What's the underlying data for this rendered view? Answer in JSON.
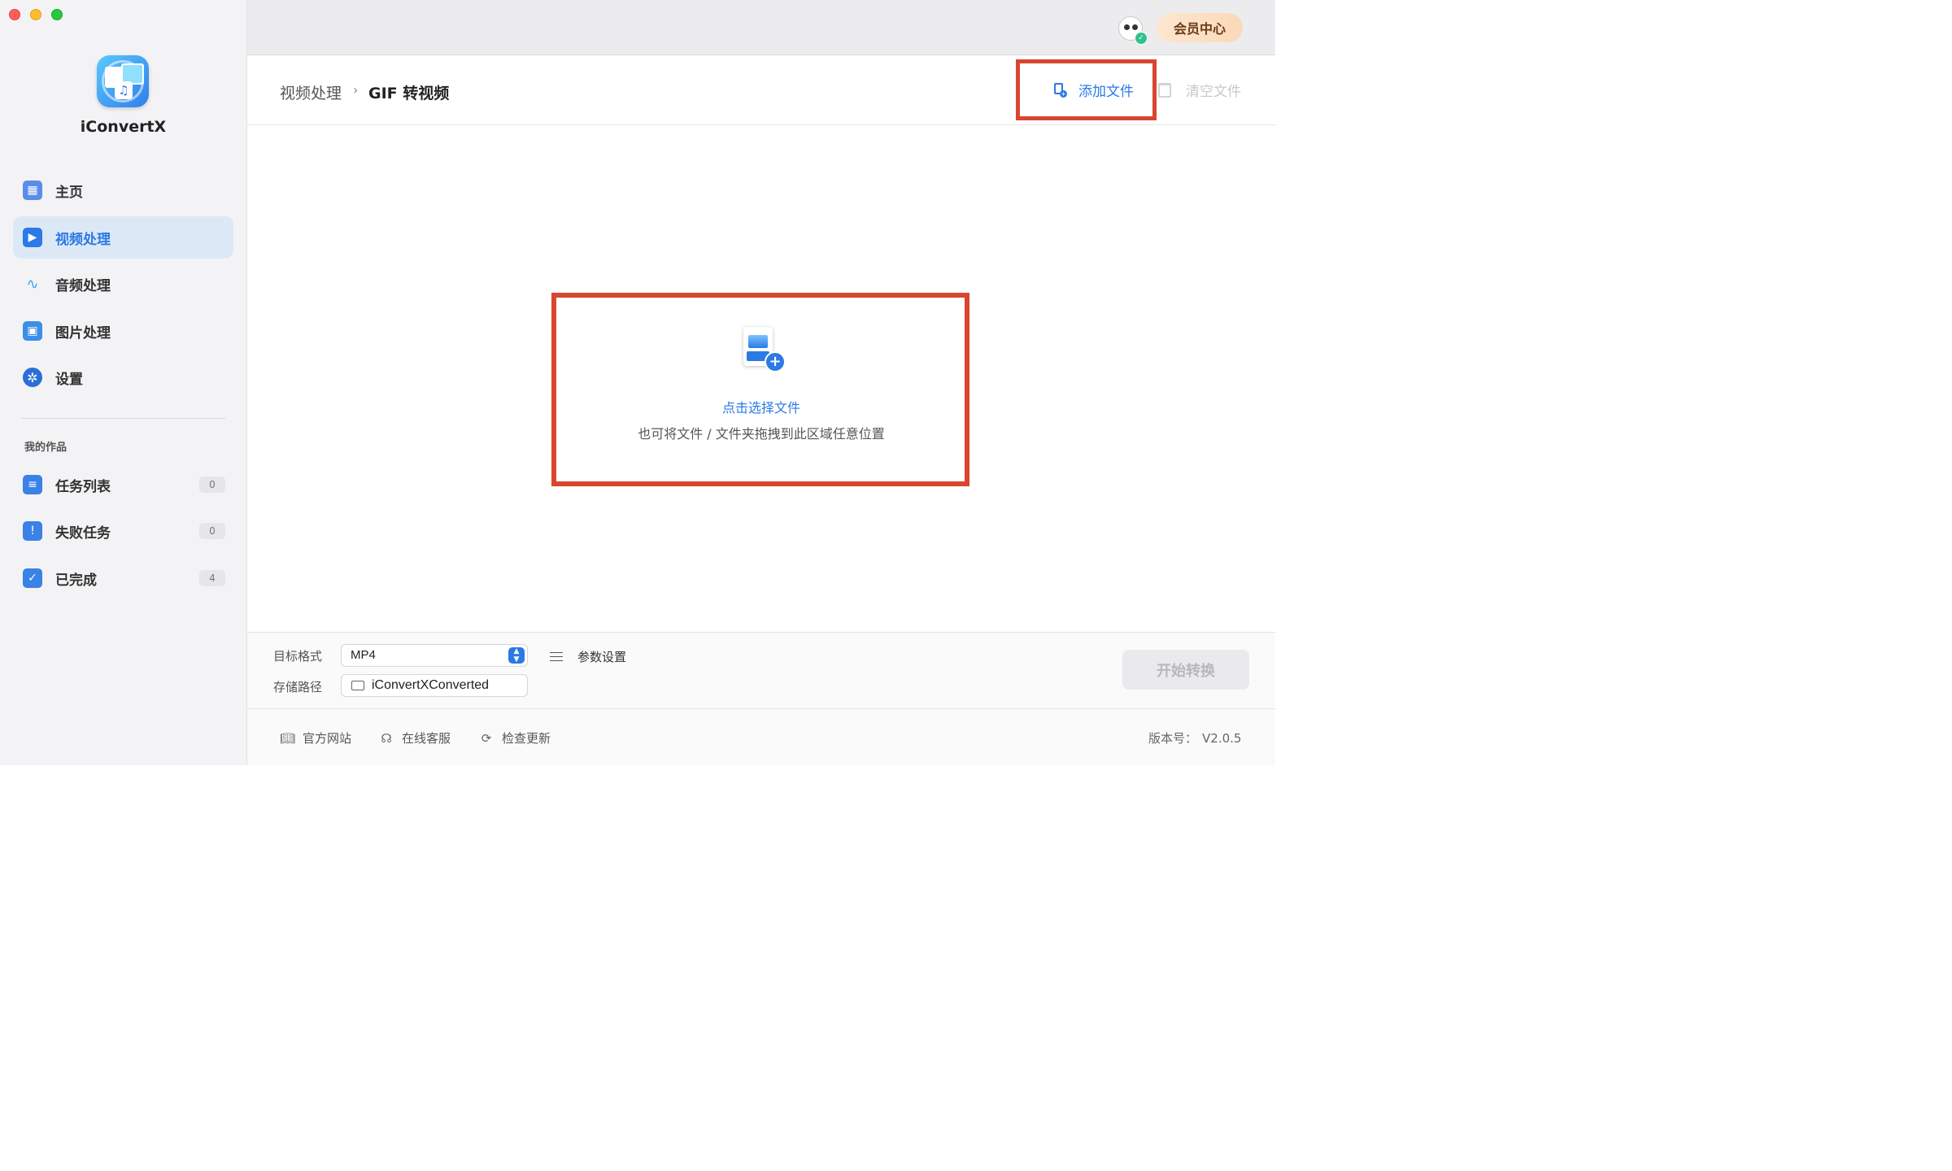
{
  "window": {
    "app_name": "iConvertX"
  },
  "topbar": {
    "vip_label": "会员中心"
  },
  "sidebar": {
    "items": [
      {
        "label": "主页",
        "icon": "home-grid-icon"
      },
      {
        "label": "视频处理",
        "icon": "video-icon",
        "active": true
      },
      {
        "label": "音频处理",
        "icon": "audio-wave-icon"
      },
      {
        "label": "图片处理",
        "icon": "image-icon"
      },
      {
        "label": "设置",
        "icon": "gear-icon"
      }
    ],
    "section_title": "我的作品",
    "works": [
      {
        "label": "任务列表",
        "count": "0",
        "icon": "task-list-icon"
      },
      {
        "label": "失败任务",
        "count": "0",
        "icon": "failed-task-icon"
      },
      {
        "label": "已完成",
        "count": "4",
        "icon": "completed-icon"
      }
    ]
  },
  "header": {
    "breadcrumb_parent": "视频处理",
    "breadcrumb_sep": "›",
    "breadcrumb_current": "GIF 转视频",
    "add_files": "添加文件",
    "clear_files": "清空文件"
  },
  "dropzone": {
    "primary": "点击选择文件",
    "secondary": "也可将文件 / 文件夹拖拽到此区域任意位置"
  },
  "settings": {
    "format_label": "目标格式",
    "format_value": "MP4",
    "path_label": "存储路径",
    "path_value": "iConvertXConverted",
    "params_label": "参数设置",
    "start_label": "开始转换"
  },
  "footer": {
    "website": "官方网站",
    "support": "在线客服",
    "update": "检查更新",
    "version_label": "版本号：",
    "version_value": "V2.0.5"
  },
  "colors": {
    "accent": "#2b7ae5",
    "highlight": "#d9462f",
    "sidebar_bg": "#f3f3f5",
    "active_bg": "#dde8f7"
  }
}
